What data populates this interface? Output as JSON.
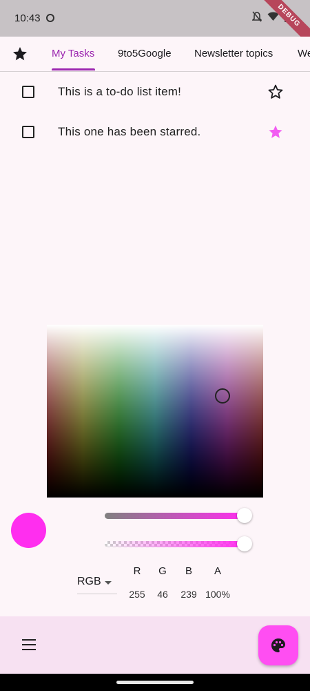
{
  "status_bar": {
    "time": "10:43",
    "debug_banner": "DEBUG",
    "icons": [
      "app-notification-icon",
      "mute-icon",
      "wifi-icon",
      "battery-icon"
    ]
  },
  "tabs": {
    "items": [
      {
        "label": "My Tasks",
        "active": true
      },
      {
        "label": "9to5Google",
        "active": false
      },
      {
        "label": "Newsletter topics",
        "active": false
      },
      {
        "label": "We",
        "active": false
      }
    ],
    "accent_color": "#9c27b0"
  },
  "tasks": [
    {
      "text": "This is a to-do list item!",
      "starred": false,
      "checked": false
    },
    {
      "text": "This one has been starred.",
      "starred": true,
      "checked": false
    }
  ],
  "color_picker": {
    "selected_color": "#ff2eef",
    "mode": "RGB",
    "channels": [
      {
        "name": "R",
        "value": "255"
      },
      {
        "name": "G",
        "value": "46"
      },
      {
        "name": "B",
        "value": "239"
      },
      {
        "name": "A",
        "value": "100%"
      }
    ],
    "hue_slider_level": 1.0,
    "alpha_slider_level": 1.0
  },
  "bottom_bar": {
    "menu_icon": "menu-icon",
    "fab_icon": "palette-icon",
    "fab_color": "#ff4ef2"
  }
}
